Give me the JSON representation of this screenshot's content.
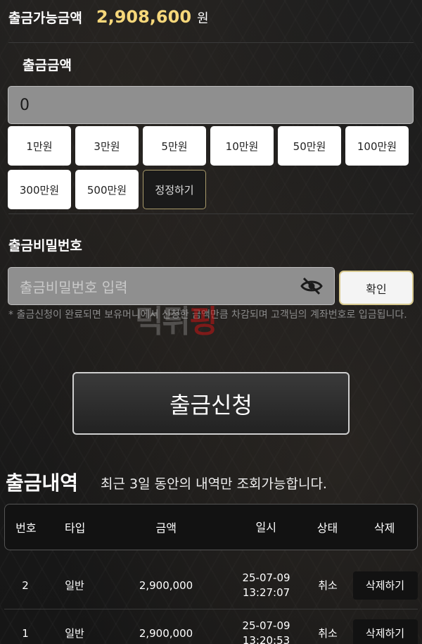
{
  "balance": {
    "label": "출금가능금액",
    "amount": "2,908,600",
    "unit": "원"
  },
  "amount_section": {
    "title": "출금금액",
    "value": "0"
  },
  "quick_amounts": [
    "1만원",
    "3만원",
    "5만원",
    "10만원",
    "50만원",
    "100만원",
    "300만원",
    "500만원"
  ],
  "reset_label": "정정하기",
  "password": {
    "title": "출금비밀번호",
    "placeholder": "출금비밀번호 입력",
    "confirm_label": "확인"
  },
  "notice": "* 출금신청이 완료되면 보유머니에서 신청한 금액만큼 차감되며 고객님의 계좌번호로 입금됩니다.",
  "watermark": {
    "text": "먹튀",
    "tail": "핑"
  },
  "submit_label": "출금신청",
  "history": {
    "title": "출금내역",
    "note": "최근 3일 동안의 내역만 조회가능합니다.",
    "headers": [
      "번호",
      "타입",
      "금액",
      "일시",
      "상태",
      "삭제"
    ],
    "rows": [
      {
        "no": "2",
        "type": "일반",
        "amount": "2,900,000",
        "date": "25-07-09",
        "time": "13:27:07",
        "status": "취소",
        "action": "삭제하기"
      },
      {
        "no": "1",
        "type": "일반",
        "amount": "2,900,000",
        "date": "25-07-09",
        "time": "13:20:53",
        "status": "취소",
        "action": "삭제하기"
      }
    ]
  }
}
